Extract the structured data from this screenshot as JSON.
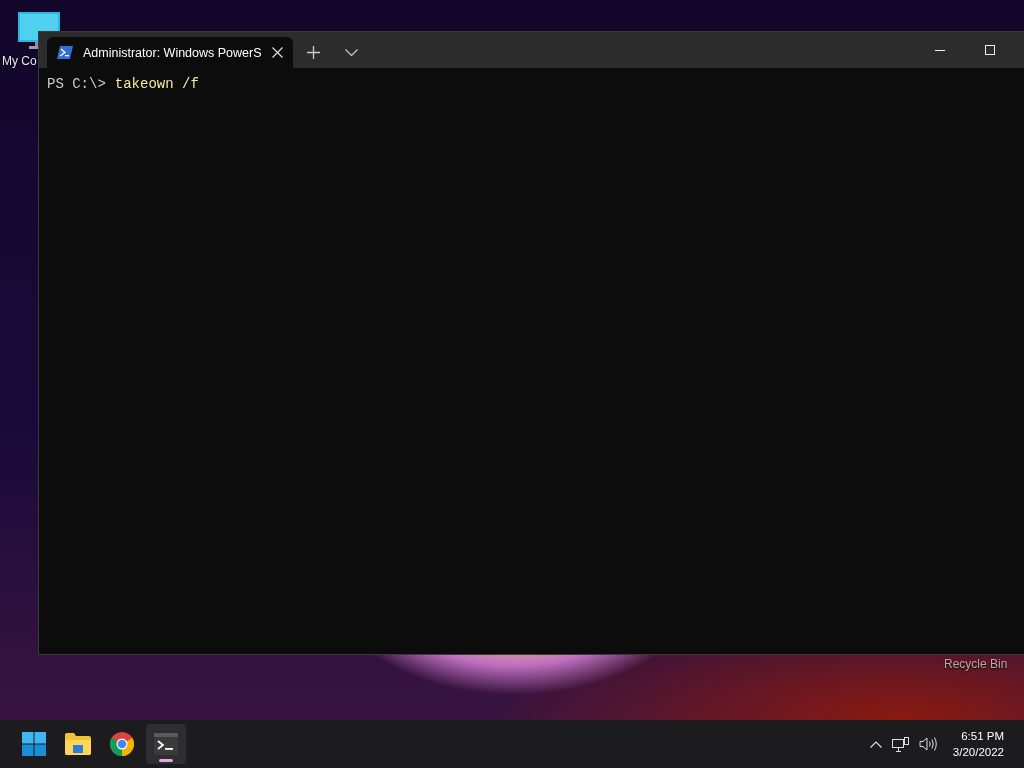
{
  "desktop": {
    "icons": [
      {
        "kind": "computer",
        "label": "My Co"
      },
      {
        "kind": "bin",
        "label": "Recycle Bin"
      }
    ]
  },
  "window": {
    "tabs": [
      {
        "title": "Administrator: Windows PowerS",
        "selected": true
      }
    ],
    "lines": [
      {
        "prompt": "PS C:\\>",
        "command": "takeown /f"
      }
    ]
  },
  "taskbar": {
    "apps": [
      {
        "kind": "start",
        "active": false
      },
      {
        "kind": "explorer",
        "active": false
      },
      {
        "kind": "chrome",
        "active": false
      },
      {
        "kind": "terminal",
        "active": true
      }
    ],
    "clock": {
      "time": "6:51 PM",
      "date": "3/20/2022"
    }
  }
}
